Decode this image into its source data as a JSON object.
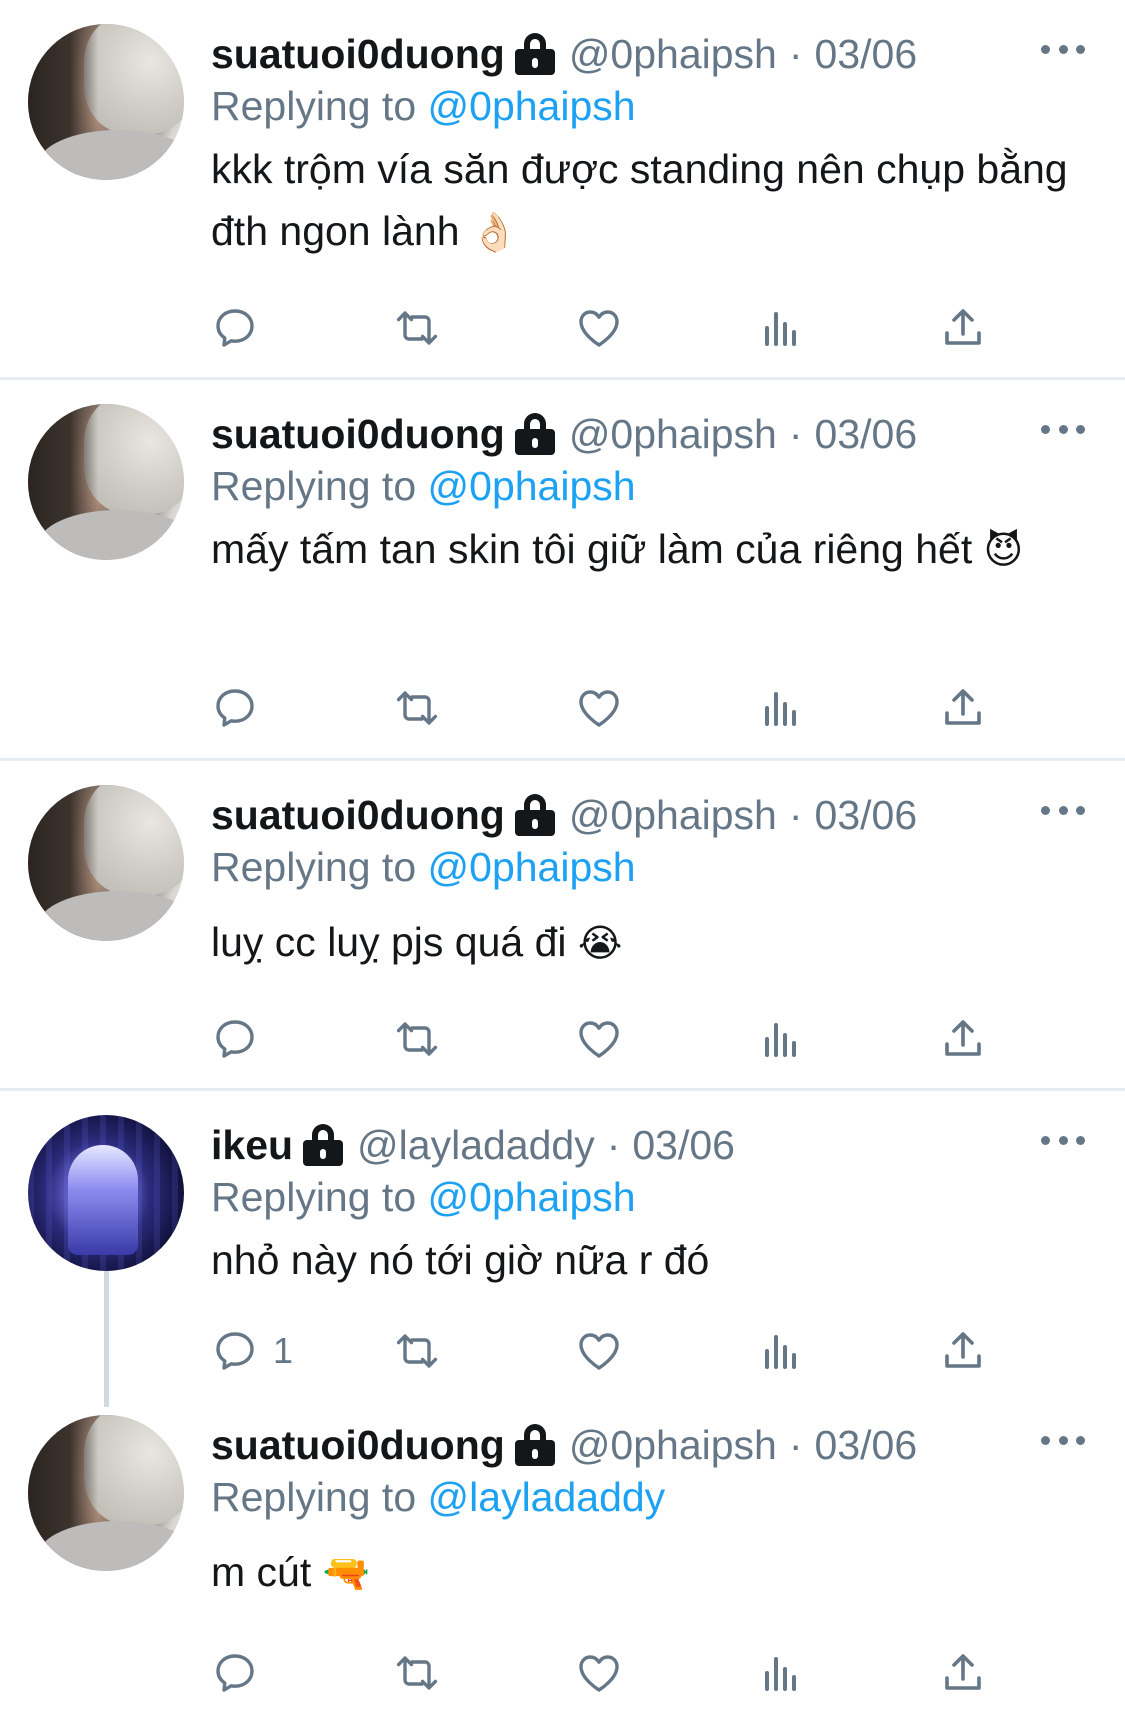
{
  "colors": {
    "text": "#14171a",
    "secondary": "#657786",
    "accent": "#1da1f2",
    "divider": "#e6ecf0",
    "thread_line": "#cfd9de"
  },
  "header": {
    "separator": "·"
  },
  "tweets": [
    {
      "name": "suatuoi0duong",
      "handle": "@0phaipsh",
      "date": "03/06",
      "replying_label": "Replying to",
      "replying_to": "@0phaipsh",
      "text": "kkk trộm vía săn được standing nên chụp bằng đth ngon lành",
      "emoji": "👌🏻",
      "reply_count": ""
    },
    {
      "name": "suatuoi0duong",
      "handle": "@0phaipsh",
      "date": "03/06",
      "replying_label": "Replying to",
      "replying_to": "@0phaipsh",
      "text": "mấy tấm tan skin tôi giữ làm của riêng hết",
      "emoji": "😈",
      "reply_count": ""
    },
    {
      "name": "suatuoi0duong",
      "handle": "@0phaipsh",
      "date": "03/06",
      "replying_label": "Replying to",
      "replying_to": "@0phaipsh",
      "text": "luỵ cc luỵ pjs quá đi",
      "emoji": "😭",
      "reply_count": ""
    },
    {
      "name": "ikeu",
      "handle": "@layladaddy",
      "date": "03/06",
      "replying_label": "Replying to",
      "replying_to": "@0phaipsh",
      "text": "nhỏ này nó tới giờ nữa r đó",
      "emoji": "",
      "reply_count": "1"
    },
    {
      "name": "suatuoi0duong",
      "handle": "@0phaipsh",
      "date": "03/06",
      "replying_label": "Replying to",
      "replying_to": "@layladaddy",
      "text": "m cút",
      "emoji": "🔫",
      "reply_count": ""
    }
  ],
  "icons": {
    "reply": "reply-icon",
    "retweet": "retweet-icon",
    "like": "heart-icon",
    "stats": "analytics-icon",
    "share": "share-icon",
    "more": "more-icon",
    "lock": "lock-icon"
  }
}
